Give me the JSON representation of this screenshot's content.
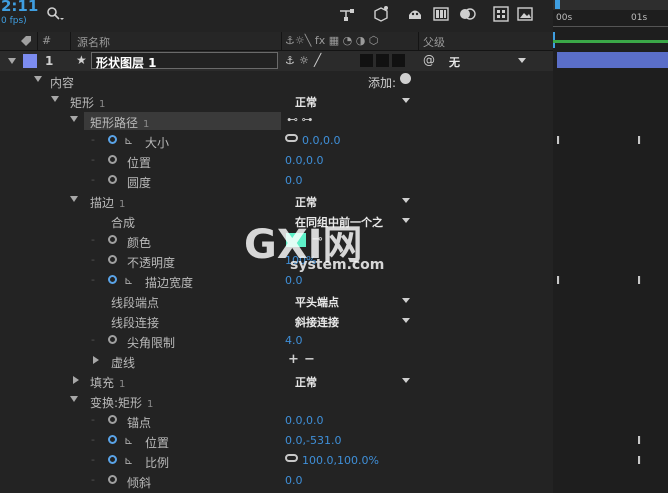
{
  "timecode": "2:11",
  "fps": "0 fps)",
  "header": {
    "hash": "#",
    "source_name": "源名称",
    "switches": "⚓☼╲ fx ▦ ◔ ◑ ⬡",
    "parent": "父级"
  },
  "timeline": {
    "t0": "00s",
    "t1": "01s"
  },
  "layer": {
    "number": "1",
    "name": "形状图层 1",
    "parent_value": "无",
    "label_color": "#7c8cf0"
  },
  "rows": {
    "contents": "内容",
    "add": "添加:",
    "rect": "矩形",
    "rect_idx": "1",
    "rect_blend": "正常",
    "rect_path": "矩形路径",
    "rect_path_idx": "1",
    "size": "大小",
    "size_val": "0.0,0.0",
    "position": "位置",
    "position_val": "0.0,0.0",
    "roundness": "圆度",
    "roundness_val": "0.0",
    "stroke": "描边",
    "stroke_idx": "1",
    "stroke_blend": "正常",
    "composite": "合成",
    "composite_val": "在同组中前一个之",
    "color": "颜色",
    "opacity": "不透明度",
    "opacity_val": "100%",
    "stroke_width": "描边宽度",
    "stroke_width_val": "0.0",
    "line_cap": "线段端点",
    "line_cap_val": "平头端点",
    "line_join": "线段连接",
    "line_join_val": "斜接连接",
    "miter": "尖角限制",
    "miter_val": "4.0",
    "dashes": "虚线",
    "fill": "填充",
    "fill_idx": "1",
    "fill_blend": "正常",
    "transform": "变换:矩形",
    "transform_idx": "1",
    "anchor": "锚点",
    "anchor_val": "0.0,0.0",
    "t_position": "位置",
    "t_position_val": "0.0,-531.0",
    "scale": "比例",
    "scale_val": "100.0,100.0%",
    "skew": "倾斜",
    "skew_val": "0.0"
  },
  "colors": {
    "accent": "#3f9ee0",
    "stroke_swatch": "#5ef0c8"
  },
  "watermark": {
    "line1": "GXI网",
    "line2": "system.com"
  }
}
